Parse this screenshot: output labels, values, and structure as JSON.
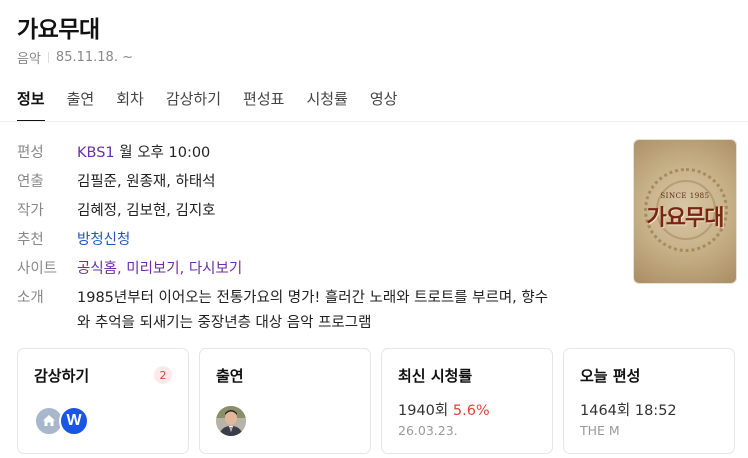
{
  "program": {
    "title": "가요무대",
    "genre": "음악",
    "start_date": "85.11.18. ~"
  },
  "tabs": [
    {
      "label": "정보",
      "active": true
    },
    {
      "label": "출연",
      "active": false
    },
    {
      "label": "회차",
      "active": false
    },
    {
      "label": "감상하기",
      "active": false
    },
    {
      "label": "편성표",
      "active": false
    },
    {
      "label": "시청률",
      "active": false
    },
    {
      "label": "영상",
      "active": false
    }
  ],
  "info": {
    "schedule": {
      "label": "편성",
      "channel": "KBS1",
      "time": "월 오후 10:00"
    },
    "director": {
      "label": "연출",
      "value": "김필준, 원종재, 하태석"
    },
    "writer": {
      "label": "작가",
      "value": "김혜정, 김보현, 김지호"
    },
    "recommend": {
      "label": "추천",
      "value": "방청신청"
    },
    "site": {
      "label": "사이트",
      "links": [
        "공식홈",
        "미리보기",
        "다시보기"
      ],
      "separator": ", "
    },
    "intro": {
      "label": "소개",
      "line1": "1985년부터 이어오는 전통가요의 명가! 흘러간 노래와 트로트를 부르며, 향수",
      "line2": "와 추억을 되새기는 중장년층 대상 음악 프로그램"
    }
  },
  "poster": {
    "since": "SINCE 1985",
    "logo": "가요무대"
  },
  "cards": {
    "watch": {
      "title": "감상하기",
      "count": "2",
      "icons": [
        "home-icon",
        "wavve-icon"
      ],
      "wavve_letter": "W"
    },
    "cast": {
      "title": "출연"
    },
    "rating": {
      "title": "최신 시청률",
      "episode": "1940회",
      "value": "5.6%",
      "date": "26.03.23."
    },
    "today": {
      "title": "오늘 편성",
      "episode": "1464회",
      "time": "18:52",
      "channel": "THE M"
    }
  },
  "colors": {
    "accent_red": "#e0433a",
    "link_purple": "#6b2ea6",
    "link_blue": "#2557b5",
    "wavve_blue": "#1a56e6"
  }
}
